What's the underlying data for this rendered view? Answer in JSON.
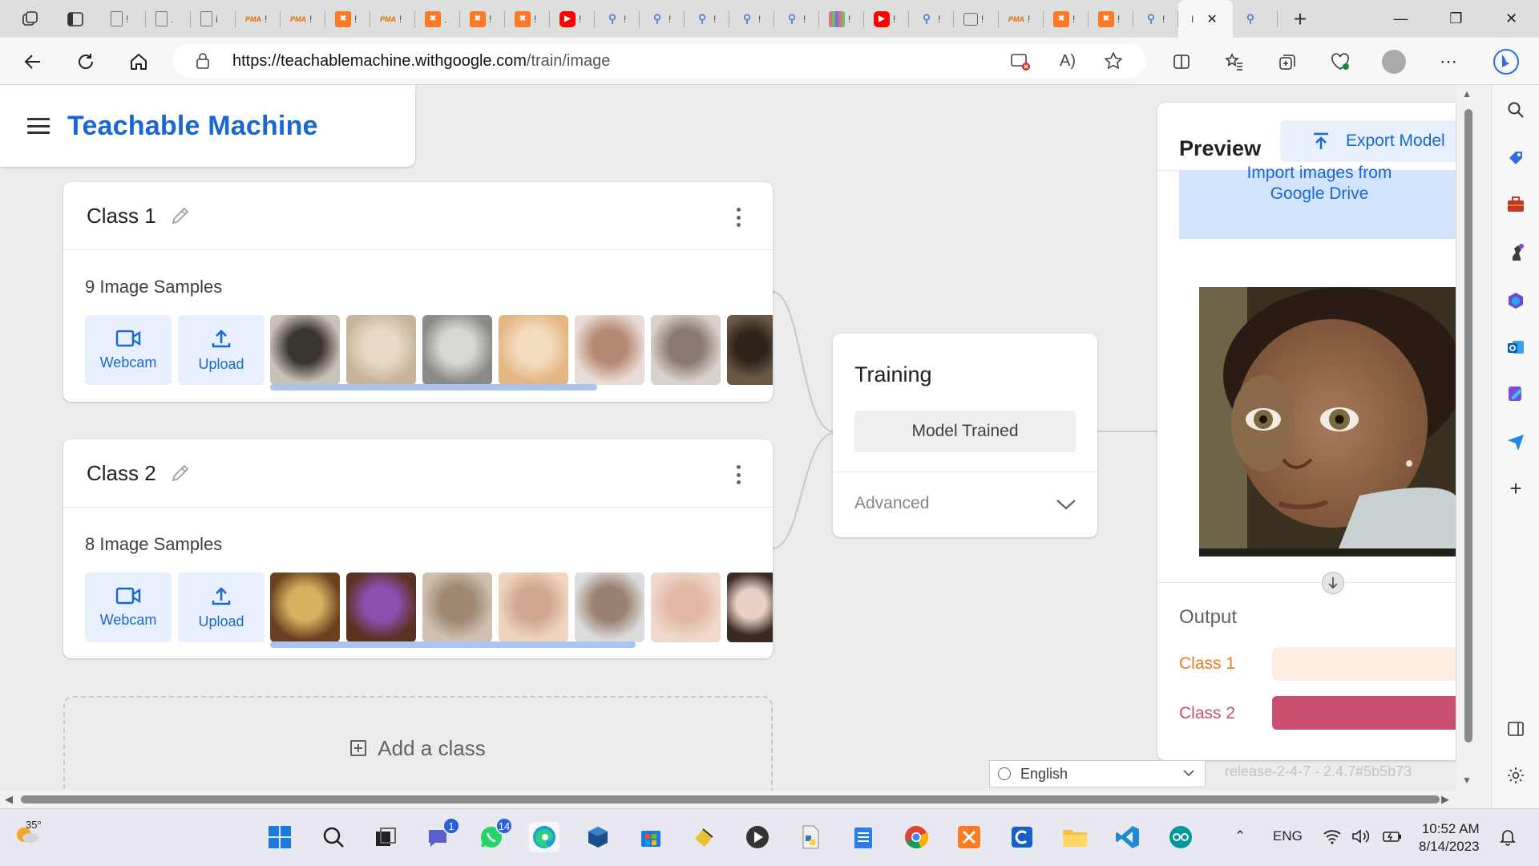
{
  "browser": {
    "url_host": "https://teachablemachine.withgoogle.com",
    "url_path": "/train/image",
    "tabs": [
      {
        "icon": "doc",
        "text": "!"
      },
      {
        "icon": "doc",
        "text": "."
      },
      {
        "icon": "doc",
        "text": "i"
      },
      {
        "icon": "pma",
        "text": "!"
      },
      {
        "icon": "pma",
        "text": "!"
      },
      {
        "icon": "xampp",
        "text": "!"
      },
      {
        "icon": "pma",
        "text": "!"
      },
      {
        "icon": "xampp",
        "text": "."
      },
      {
        "icon": "xampp",
        "text": "!"
      },
      {
        "icon": "xampp",
        "text": "!"
      },
      {
        "icon": "youtube",
        "text": "!"
      },
      {
        "icon": "search",
        "text": "!"
      },
      {
        "icon": "search",
        "text": "!"
      },
      {
        "icon": "search",
        "text": "!"
      },
      {
        "icon": "search",
        "text": "!"
      },
      {
        "icon": "search",
        "text": "!"
      },
      {
        "icon": "grid",
        "text": "!"
      },
      {
        "icon": "youtube",
        "text": "!"
      },
      {
        "icon": "search",
        "text": "!"
      },
      {
        "icon": "calendar",
        "text": "!"
      },
      {
        "icon": "pma",
        "text": "!"
      },
      {
        "icon": "xampp",
        "text": "!"
      },
      {
        "icon": "xampp",
        "text": "!"
      },
      {
        "icon": "search",
        "text": "!"
      },
      {
        "icon": "active",
        "text": "I"
      },
      {
        "icon": "search",
        "text": ""
      }
    ],
    "new_tab": "+"
  },
  "app": {
    "title": "Teachable Machine"
  },
  "classes": [
    {
      "name": "Class 1",
      "samples_label": "9 Image Samples",
      "webcam_label": "Webcam",
      "upload_label": "Upload",
      "thumb_colors": [
        [
          "#c9c2b9",
          "#3b3530"
        ],
        [
          "#c9b49a",
          "#e8dac7"
        ],
        [
          "#8a8a86",
          "#d9d7d2"
        ],
        [
          "#e5b683",
          "#f3dcc0"
        ],
        [
          "#e9dcd6",
          "#b58a74"
        ],
        [
          "#d8d2cc",
          "#8a7a70"
        ],
        [
          "#6a5845",
          "#2c2418"
        ]
      ],
      "scroll_fraction": 0.85
    },
    {
      "name": "Class 2",
      "samples_label": "8 Image Samples",
      "webcam_label": "Webcam",
      "upload_label": "Upload",
      "thumb_colors": [
        [
          "#6a4020",
          "#d8b060"
        ],
        [
          "#5a3220",
          "#8c4fb0"
        ],
        [
          "#cfc0b2",
          "#a08870"
        ],
        [
          "#f0d4c0",
          "#d0a890"
        ],
        [
          "#dcdcdc",
          "#9a8070"
        ],
        [
          "#f0d8cc",
          "#e0b8a4"
        ],
        [
          "#3a2a24",
          "#e8d0c4"
        ]
      ],
      "scroll_fraction": 0.95
    }
  ],
  "add_class_label": "Add a class",
  "training": {
    "title": "Training",
    "button_label": "Model Trained",
    "advanced_label": "Advanced"
  },
  "preview": {
    "title": "Preview",
    "export_label": "Export Model",
    "gdrive_label": "Import images from Google Drive",
    "output_title": "Output",
    "outputs": [
      {
        "label": "Class 1",
        "color": "#e67c21",
        "track_color": "#fdeee2",
        "value": 0.0
      },
      {
        "label": "Class 2",
        "color": "#c8506e",
        "track_color": "#f7dde3",
        "value": 1.0
      }
    ]
  },
  "footer": {
    "language": "English",
    "release": "release-2-4-7 - 2.4.7#5b5b73"
  },
  "taskbar": {
    "temperature": "35°",
    "teams_badge": "1",
    "whatsapp_badge": "14",
    "lang": "ENG",
    "time": "10:52 AM",
    "date": "8/14/2023"
  }
}
